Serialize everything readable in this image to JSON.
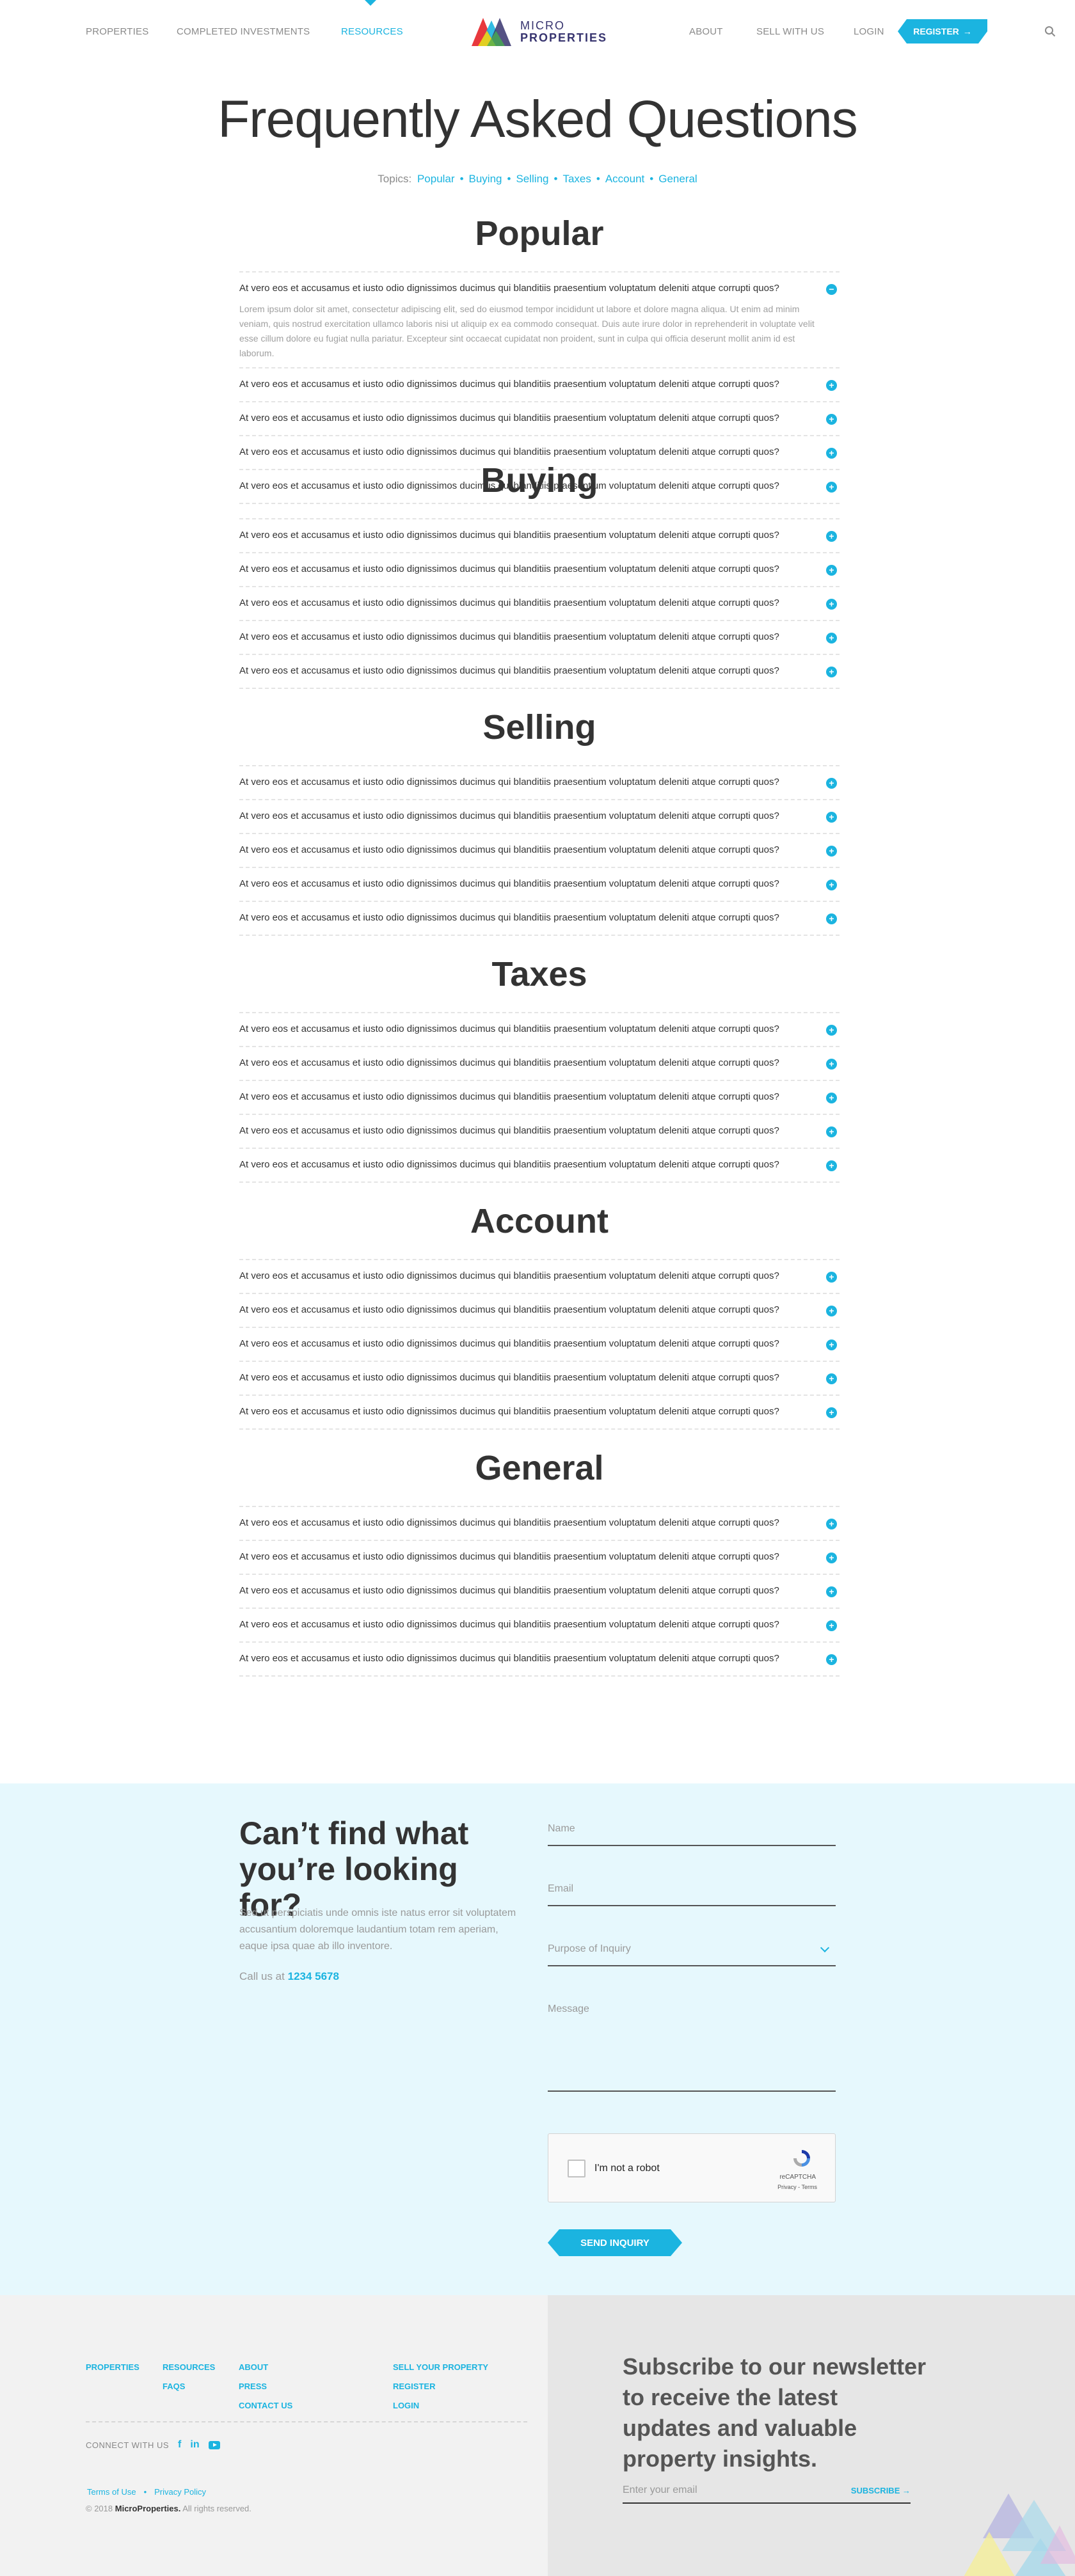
{
  "header": {
    "nav_left": [
      "PROPERTIES",
      "COMPLETED INVESTMENTS",
      "RESOURCES"
    ],
    "nav_right": [
      "ABOUT",
      "SELL WITH US",
      "LOGIN"
    ],
    "active": "RESOURCES",
    "logo_line1": "MICRO",
    "logo_line2": "PROPERTIES",
    "register_label": "REGISTER",
    "accent_color": "#1bb4e0"
  },
  "page": {
    "title": "Frequently Asked Questions",
    "topics_label": "Topics:",
    "topics": [
      "Popular",
      "Buying",
      "Selling",
      "Taxes",
      "Account",
      "General"
    ]
  },
  "faq": {
    "question": "At vero eos et accusamus et iusto odio dignissimos ducimus qui blanditiis praesentium voluptatum deleniti atque corrupti quos?",
    "open_answer": "Lorem ipsum dolor sit amet, consectetur adipiscing elit, sed do eiusmod tempor incididunt ut labore et dolore magna aliqua. Ut enim ad minim veniam, quis nostrud exercitation ullamco laboris nisi ut aliquip ex ea commodo consequat. Duis aute irure dolor in reprehenderit in voluptate velit esse cillum dolore eu fugiat nulla pariatur. Excepteur sint occaecat cupidatat non proident, sunt in culpa qui officia deserunt mollit anim id est laborum.",
    "sections": [
      {
        "heading": "Popular",
        "items": 5,
        "open_index": 0
      },
      {
        "heading": "Buying",
        "items": 5,
        "open_index": -1
      },
      {
        "heading": "Selling",
        "items": 5,
        "open_index": -1
      },
      {
        "heading": "Taxes",
        "items": 5,
        "open_index": -1
      },
      {
        "heading": "Account",
        "items": 5,
        "open_index": -1
      },
      {
        "heading": "General",
        "items": 5,
        "open_index": -1
      }
    ]
  },
  "contact": {
    "title": "Can’t find what you’re looking for?",
    "text": "Sed ut perspiciatis unde omnis iste natus error sit voluptatem accusantium doloremque laudantium totam rem aperiam, eaque ipsa quae ab illo inventore.",
    "call_prefix": "Call us at",
    "phone": "1234 5678",
    "name_label": "Name",
    "email_label": "Email",
    "purpose_label": "Purpose of Inquiry",
    "message_label": "Message",
    "captcha_text": "I'm not a robot",
    "captcha_brand": "reCAPTCHA",
    "captcha_links": "Privacy - Terms",
    "send_label": "SEND INQUIRY"
  },
  "footer": {
    "col1": [
      "PROPERTIES"
    ],
    "col2": [
      "RESOURCES",
      "FAQs"
    ],
    "col3": [
      "ABOUT",
      "PRESS",
      "CONTACT US"
    ],
    "col4": [
      "SELL YOUR PROPERTY",
      "REGISTER",
      "LOGIN"
    ],
    "connect_label": "CONNECT WITH US",
    "terms": "Terms of Use",
    "privacy": "Privacy Policy",
    "copyright_prefix": "© 2018",
    "copyright_brand": "MicroProperties.",
    "copyright_suffix": "All rights reserved.",
    "newsletter_title": "Subscribe to our newsletter to receive the latest updates and valuable property insights.",
    "email_placeholder": "Enter your email",
    "subscribe_label": "SUBSCRIBE"
  }
}
